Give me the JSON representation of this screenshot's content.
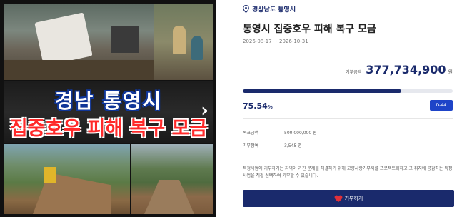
{
  "banner": {
    "line1": "경남 통영시",
    "line2": "집중호우 피해 복구 모금",
    "next_glyph": "›"
  },
  "campaign": {
    "region": "경상남도 통영시",
    "title": "통영시 집중호우 피해 복구 모금",
    "period": "2026-08-17 ~ 2026-10-31",
    "amount_label": "기부금액",
    "amount": "377,734,900",
    "amount_unit": "원",
    "progress_percent": 75.54,
    "percent_value": "75.54",
    "percent_sign": "%",
    "dday": "D-44",
    "goal_label": "목표금액",
    "goal_value": "500,000,000 원",
    "donors_label": "기부참여",
    "donors_value": "3,545 명",
    "description": "특정사업에 기부하기는 지역이 가진 문제를 해결하기 위해 고향사랑기부제를 프로젝트화하고 그 취지에 공감하는 특정사업을 직접 선택하여 기부할 수 있습니다.",
    "donate_label": "기부하기"
  },
  "colors": {
    "primary": "#1a2a6c",
    "dday_bg": "#1e44c8",
    "heart": "#e0303a"
  },
  "icons": {
    "region": "map-pin-icon",
    "donate": "heart-hand-icon",
    "banner_next": "chevron-right-icon"
  }
}
